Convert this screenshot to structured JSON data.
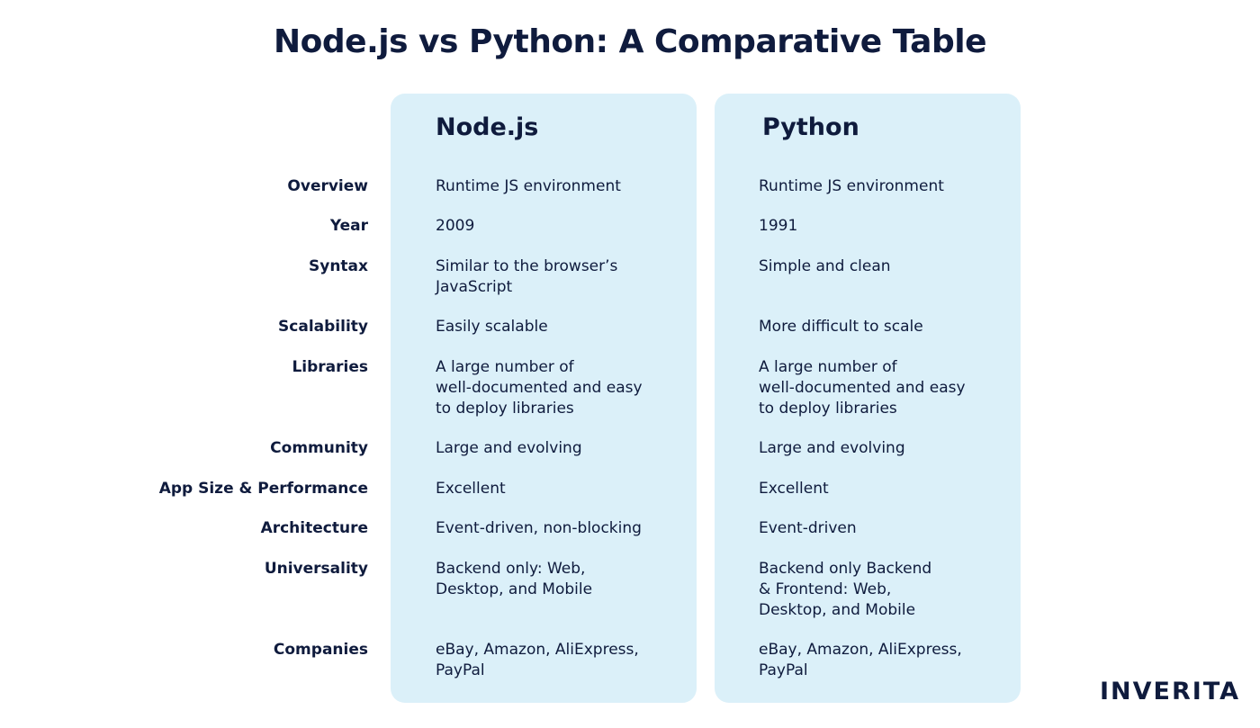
{
  "title": "Node.js vs Python: A Comparative Table",
  "columns": {
    "node": "Node.js",
    "python": "Python"
  },
  "rows": [
    {
      "label": "Overview",
      "node": "Runtime JS environment",
      "python": "Runtime JS environment"
    },
    {
      "label": "Year",
      "node": "2009",
      "python": "1991"
    },
    {
      "label": "Syntax",
      "node": "Similar to the browser’s\nJavaScript",
      "python": "Simple and clean"
    },
    {
      "label": "Scalability",
      "node": "Easily scalable",
      "python": "More difficult to scale"
    },
    {
      "label": "Libraries",
      "node": "A large number of\nwell-documented and easy\nto deploy libraries",
      "python": "A large number of\nwell-documented and easy\nto deploy libraries"
    },
    {
      "label": "Community",
      "node": "Large and evolving",
      "python": "Large and evolving"
    },
    {
      "label": "App Size & Performance",
      "node": "Excellent",
      "python": "Excellent"
    },
    {
      "label": "Architecture",
      "node": "Event-driven, non-blocking",
      "python": "Event-driven"
    },
    {
      "label": "Universality",
      "node": "Backend only: Web,\nDesktop, and Mobile",
      "python": "Backend only Backend\n& Frontend: Web,\nDesktop, and Mobile"
    },
    {
      "label": "Companies",
      "node": "eBay, Amazon, AliExpress,\nPayPal",
      "python": "eBay, Amazon, AliExpress,\nPayPal"
    }
  ],
  "logo": "INVERITA"
}
